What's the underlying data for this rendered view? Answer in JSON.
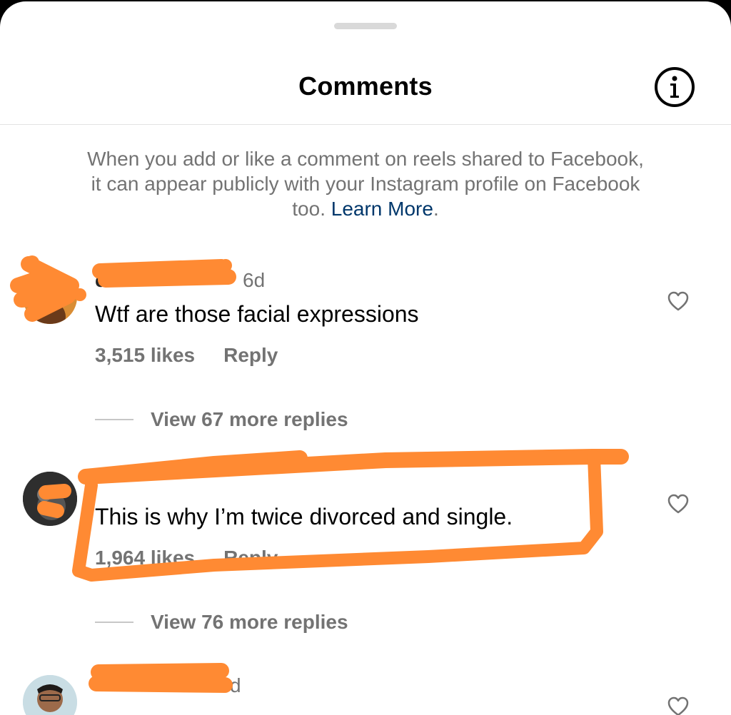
{
  "header": {
    "title": "Comments"
  },
  "notice": {
    "text": "When you add or like a comment on reels shared to Facebook, it can appear publicly with your Instagram profile on Facebook too.",
    "link": "Learn More",
    "end": "."
  },
  "comments": [
    {
      "username": "c",
      "time": "6d",
      "text": "Wtf are those facial expressions",
      "likes": "3,515 likes",
      "reply": "Reply",
      "view_replies": "View 67 more replies"
    },
    {
      "username": "",
      "time": "",
      "text": "This is why I’m twice divorced and single.",
      "likes": "1,964 likes",
      "reply": "Reply",
      "view_replies": "View 76 more replies"
    },
    {
      "username": "",
      "time": "d",
      "text": "",
      "likes": "",
      "reply": ""
    }
  ],
  "colors": {
    "background": "#ffffff",
    "text": "#000000",
    "secondary_text": "#737373",
    "link": "#00376b",
    "redaction": "#ff8a33"
  },
  "icons": {
    "info": "info-circle-icon",
    "like": "heart-outline-icon"
  }
}
